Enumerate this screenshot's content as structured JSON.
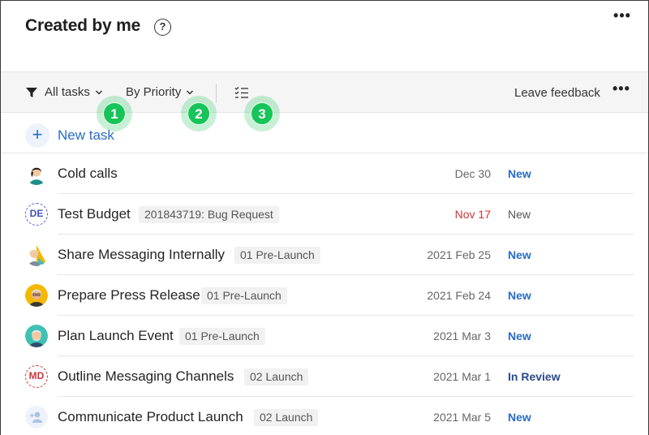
{
  "header": {
    "title": "Created by me",
    "help_glyph": "?",
    "more_glyph": "•••"
  },
  "toolbar": {
    "filter_label": "All tasks",
    "sort_label": "By Priority",
    "feedback_label": "Leave feedback",
    "more_glyph": "•••"
  },
  "badges": [
    {
      "label": "1"
    },
    {
      "label": "2"
    },
    {
      "label": "3"
    }
  ],
  "new_task": {
    "label": "New task",
    "plus_glyph": "+"
  },
  "tasks": [
    {
      "title": "Cold calls",
      "tag": "",
      "due": "Dec 30",
      "status": "New",
      "avatar": "person-icon-dark-hair"
    },
    {
      "title": "Test Budget",
      "tag": "201843719: Bug Request",
      "due": "Nov 17",
      "status": "New",
      "avatar_initials": "DE"
    },
    {
      "title": "Share Messaging Internally",
      "tag": "01 Pre-Launch",
      "due": "2021 Feb 25",
      "status": "New",
      "avatar": "person-icon-blonde"
    },
    {
      "title": "Prepare Press Release",
      "tag": "01 Pre-Launch",
      "due": "2021 Feb 24",
      "status": "New",
      "avatar": "person-icon-yellow"
    },
    {
      "title": "Plan Launch Event",
      "tag": "01 Pre-Launch",
      "due": "2021 Mar 3",
      "status": "New",
      "avatar": "person-icon-teal"
    },
    {
      "title": "Outline Messaging Channels",
      "tag": "02 Launch",
      "due": "2021 Mar 1",
      "status": "In Review",
      "avatar_initials": "MD"
    },
    {
      "title": "Communicate Product Launch",
      "tag": "02 Launch",
      "due": "2021 Mar 5",
      "status": "New",
      "avatar": "add-person-icon"
    }
  ],
  "colors": {
    "accent": "#2b6cc4",
    "overdue": "#d13438",
    "badge": "#17c45a"
  }
}
